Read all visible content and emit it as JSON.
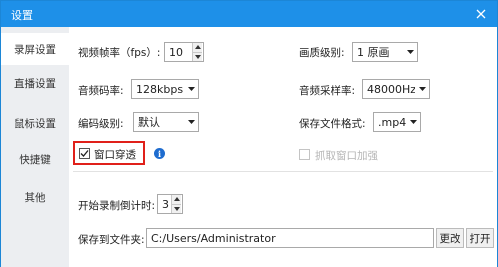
{
  "window": {
    "title": "设置",
    "accent_color": "#1e90e8",
    "highlight_color": "#e0201a"
  },
  "sidebar": {
    "items": [
      {
        "label": "录屏设置",
        "active": true
      },
      {
        "label": "直播设置",
        "active": false
      },
      {
        "label": "鼠标设置",
        "active": false
      },
      {
        "label": "快捷键",
        "active": false
      },
      {
        "label": "其他",
        "active": false
      }
    ]
  },
  "record": {
    "fps_label": "视频帧率（fps）:",
    "fps_value": "10",
    "quality_label": "画质级别:",
    "quality_value": "1 原画",
    "audio_bitrate_label": "音频码率:",
    "audio_bitrate_value": "128kbps",
    "sample_rate_label": "音频采样率:",
    "sample_rate_value": "48000Hz",
    "encode_label": "编码级别:",
    "encode_value": "默认",
    "format_label": "保存文件格式:",
    "format_value": ".mp4",
    "window_through_label": "窗口穿透",
    "window_through_checked": true,
    "capture_enhance_label": "抓取窗口加强",
    "capture_enhance_checked": false,
    "countdown_label": "开始录制倒计时:",
    "countdown_value": "3",
    "save_path_label": "保存到文件夹:",
    "save_path_value": "C:/Users/Administrator",
    "change_button": "更改",
    "open_button": "打开"
  }
}
